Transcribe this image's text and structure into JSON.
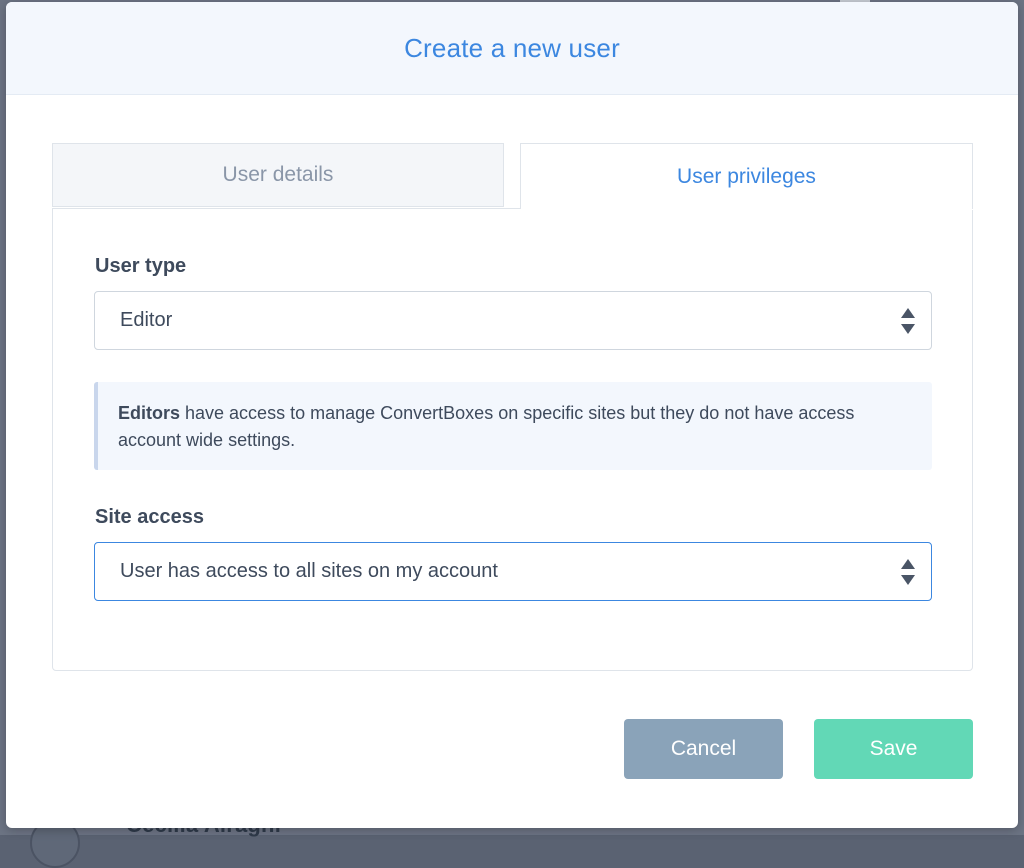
{
  "modal": {
    "title": "Create a new user"
  },
  "tabs": [
    {
      "label": "User details",
      "active": false
    },
    {
      "label": "User privileges",
      "active": true
    }
  ],
  "user_type": {
    "label": "User type",
    "value": "Editor",
    "info_bold": "Editors",
    "info_text": " have access to manage ConvertBoxes on specific sites but they do not have access account wide settings."
  },
  "site_access": {
    "label": "Site access",
    "value": "User has access to all sites on my account"
  },
  "buttons": {
    "cancel": "Cancel",
    "save": "Save"
  },
  "background": {
    "partial_name": "Cecilia Airaghi"
  },
  "colors": {
    "accent": "#3c87e0",
    "save": "#62d8b6",
    "cancel": "#8aa3b9"
  }
}
